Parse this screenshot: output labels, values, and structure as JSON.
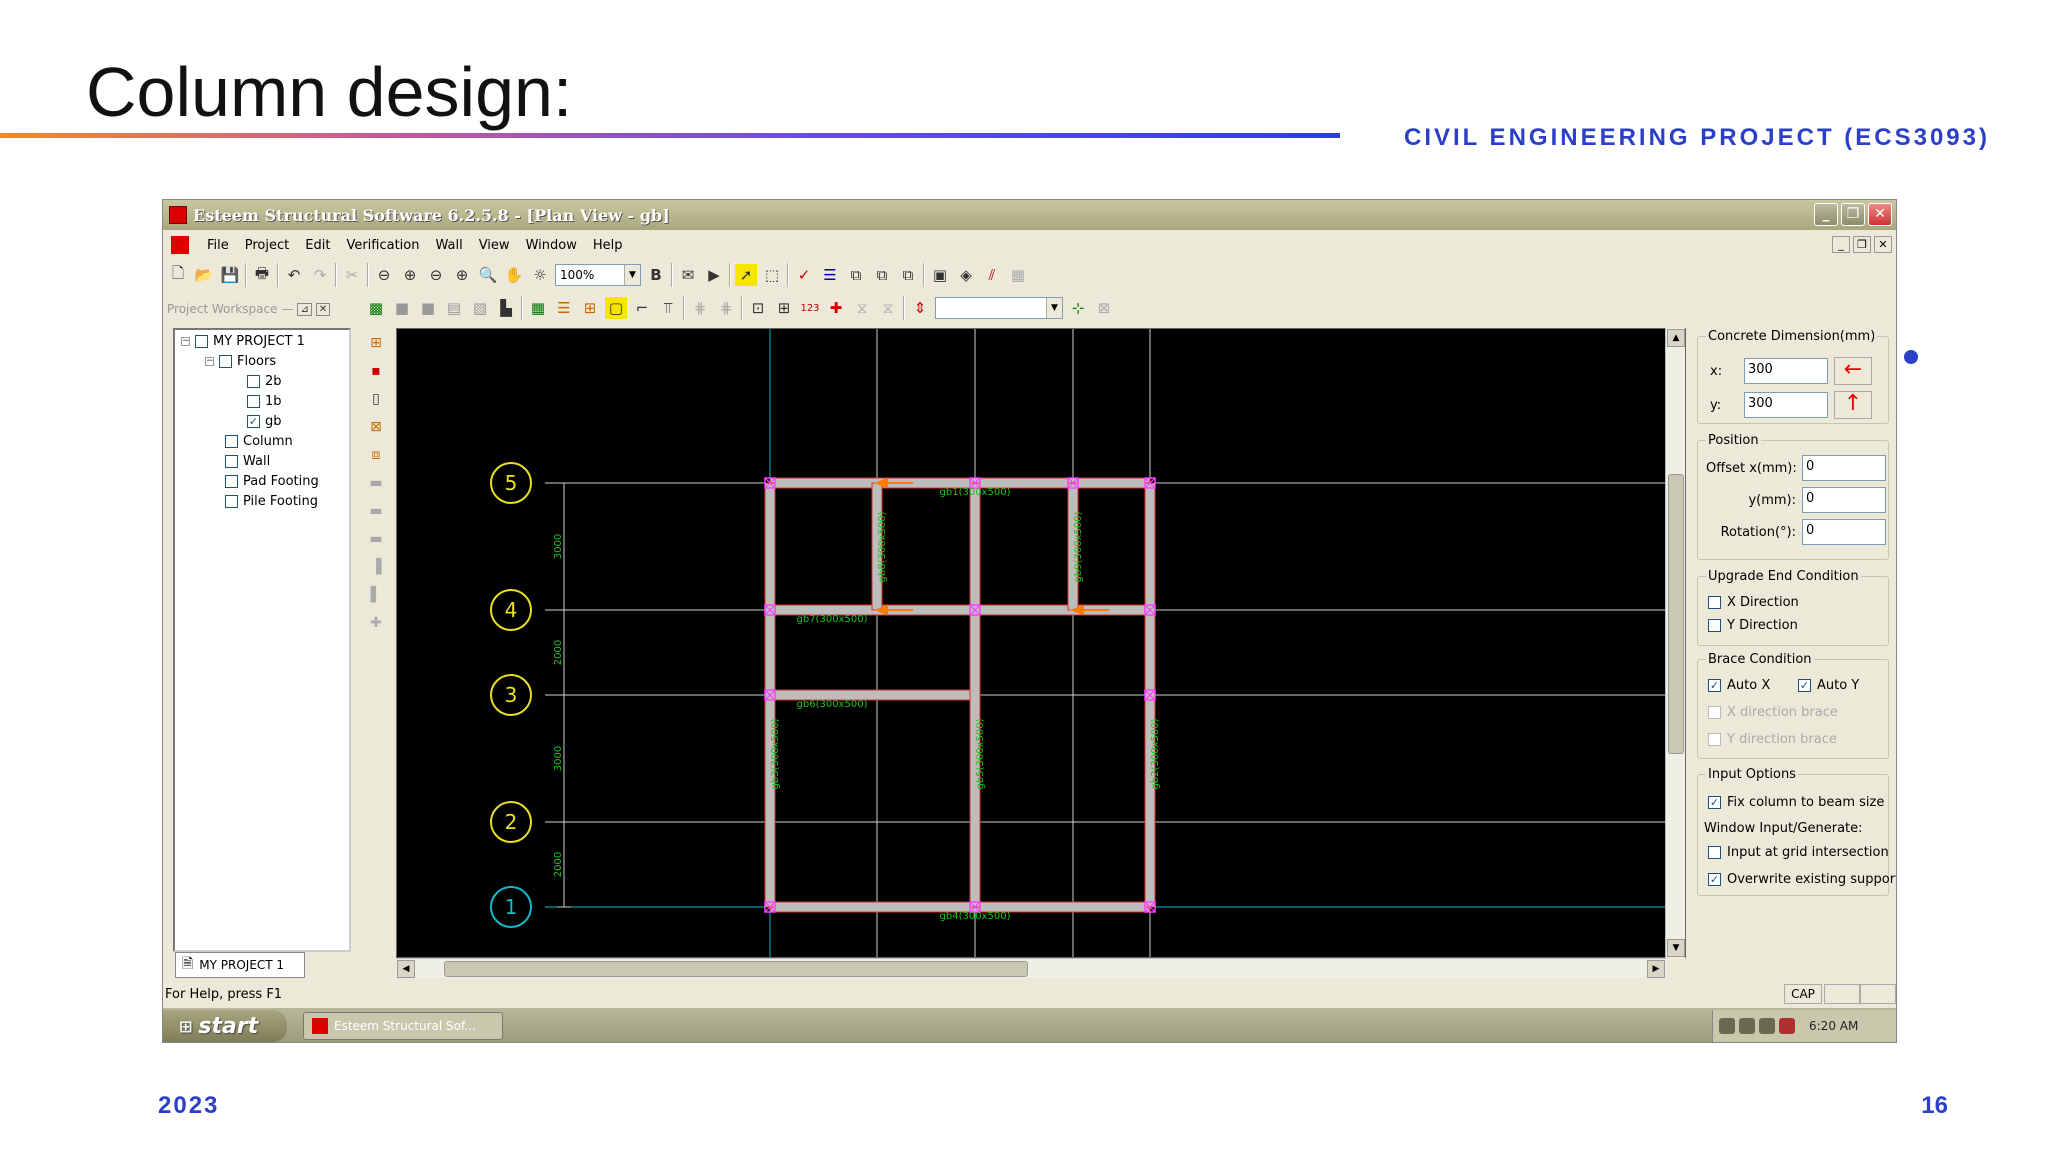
{
  "slide": {
    "title": "Column design:",
    "course": "CIVIL ENGINEERING PROJECT (ECS3093)",
    "year": "2023",
    "page_number": "16"
  },
  "app": {
    "title": "Esteem Structural Software 6.2.5.8 - [Plan View - gb]",
    "menu": [
      "File",
      "Project",
      "Edit",
      "Verification",
      "Wall",
      "View",
      "Window",
      "Help"
    ],
    "zoom_value": "100%",
    "bold_label": "B",
    "numbering_label": "123",
    "workspace_header": "Project Workspace",
    "tree": {
      "project": "MY PROJECT 1",
      "floors": "Floors",
      "floor_items": [
        {
          "label": "2b",
          "checked": false
        },
        {
          "label": "1b",
          "checked": false
        },
        {
          "label": "gb",
          "checked": true
        }
      ],
      "others": [
        "Column",
        "Wall",
        "Pad Footing",
        "Pile Footing"
      ]
    },
    "workspace_tab": "MY PROJECT 1",
    "status_text": "For Help, press F1",
    "cap_indicator": "CAP"
  },
  "plan": {
    "grid_labels": [
      "5",
      "4",
      "3",
      "2",
      "1"
    ],
    "dimensions": [
      "3000",
      "2000",
      "3000",
      "2000"
    ],
    "beam_labels": {
      "gb1": "gb1(300x500)",
      "gb7": "gb7(300x500)",
      "gb6": "gb6(300x500)",
      "gb4": "gb4(300x500)",
      "gb8": "gb8(300x500)",
      "gb9": "gb9(300x500)",
      "gb3": "gb3(300x500)",
      "gb5": "gb5(300x500)",
      "gb2": "gb2(300x500)"
    },
    "colors": {
      "background": "#000000",
      "beam_outline": "#e03030",
      "beam_fill": "#bdbdbd",
      "node": "#ff40ff",
      "label": "#20c020",
      "grid": "#d0d0d0",
      "cyan_grid": "#18b8c8",
      "bubble": "#e8e020",
      "arrow": "#ff7a00"
    }
  },
  "right_panel": {
    "concrete_group": "Concrete Dimension(mm)",
    "x_label": "x:",
    "x_value": "300",
    "y_label": "y:",
    "y_value": "300",
    "position_group": "Position",
    "offset_x_label": "Offset x(mm):",
    "offset_x_value": "0",
    "offset_y_label": "y(mm):",
    "offset_y_value": "0",
    "rotation_label": "Rotation(°):",
    "rotation_value": "0",
    "upgrade_group": "Upgrade End Condition",
    "x_direction": "X Direction",
    "y_direction": "Y Direction",
    "brace_group": "Brace Condition",
    "auto_x": "Auto X",
    "auto_y": "Auto Y",
    "x_brace": "X direction brace",
    "y_brace": "Y direction brace",
    "input_group": "Input Options",
    "fix_column": "Fix column to beam size",
    "window_input": "Window Input/Generate:",
    "input_grid": "Input at grid intersection",
    "overwrite": "Overwrite existing support"
  },
  "taskbar": {
    "start_label": "start",
    "task_label": "Esteem Structural Sof...",
    "clock": "6:20 AM"
  }
}
